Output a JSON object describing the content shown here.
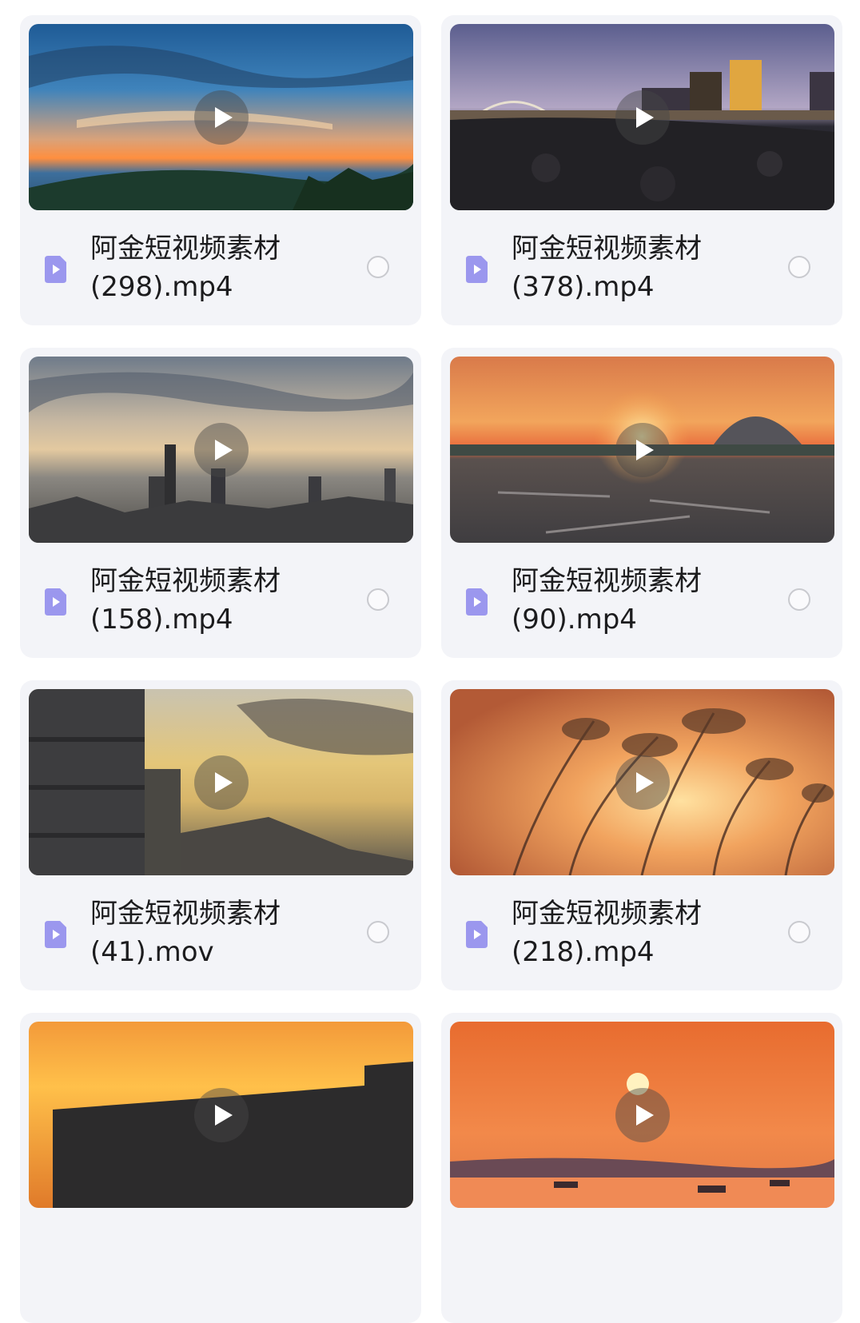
{
  "files": [
    {
      "title": "阿金短视频素材",
      "suffix": "(298).mp4",
      "thumbnail": "dramatic-sunset-sky-over-mountains",
      "selected": false
    },
    {
      "title": "阿金短视频素材",
      "suffix": "(378).mp4",
      "thumbnail": "night-city-skyline-over-water",
      "selected": false
    },
    {
      "title": "阿金短视频素材",
      "suffix": "(158).mp4",
      "thumbnail": "hazy-city-skyline-at-sunset",
      "selected": false
    },
    {
      "title": "阿金短视频素材",
      "suffix": "(90).mp4",
      "thumbnail": "sunset-over-plaza-with-dome-building",
      "selected": false
    },
    {
      "title": "阿金短视频素材",
      "suffix": "(41).mov",
      "thumbnail": "building-and-mountain-at-dusk",
      "selected": false
    },
    {
      "title": "阿金短视频素材",
      "suffix": "(218).mp4",
      "thumbnail": "reeds-silhouette-at-sunset",
      "selected": false
    },
    {
      "title": "",
      "suffix": "",
      "thumbnail": "orange-sky-behind-building-silhouette",
      "selected": false
    },
    {
      "title": "",
      "suffix": "",
      "thumbnail": "sun-setting-over-harbor-with-boats",
      "selected": false
    }
  ],
  "colors": {
    "card_background": "#f3f4f8",
    "file_icon": "#9b97ee",
    "radio_border": "#c9cacf"
  },
  "icons": {
    "play": "play-icon",
    "file": "video-file-icon",
    "select": "select-radio-icon"
  }
}
